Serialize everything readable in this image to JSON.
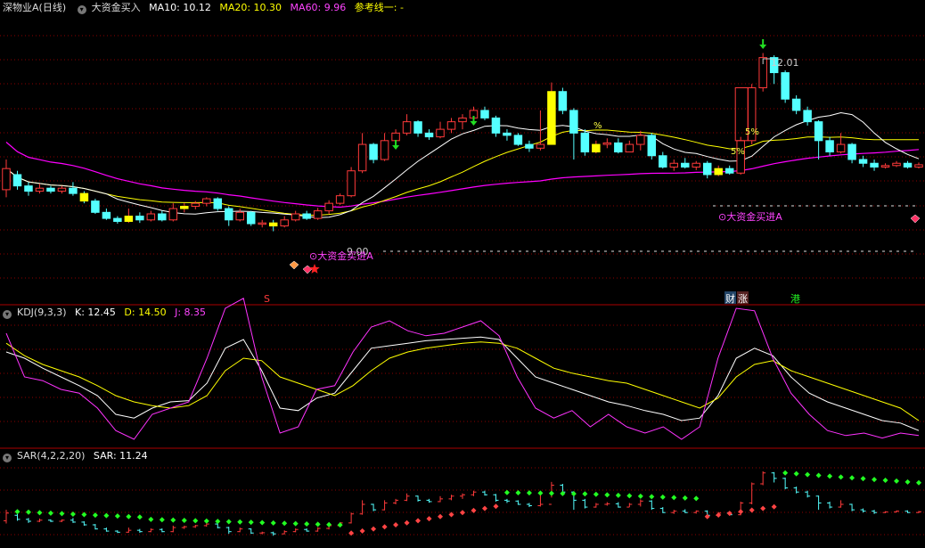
{
  "colors": {
    "up": "#ff3a3a",
    "down": "#54ffff",
    "ma10": "#ffffff",
    "ma20": "#ffff00",
    "ma60": "#ff00ff",
    "grid": "#8b0000",
    "refline": "#ffffff",
    "arrow": "#22dd22",
    "bigfund": "#ff44ff",
    "sar_green": "#22ff22",
    "sar_red": "#ff4444"
  },
  "main_header": {
    "symbol": "深物业A(日线)",
    "indicator": "大资金买入",
    "ma10": "MA10: 10.12",
    "ma20": "MA20: 10.30",
    "ma60": "MA60: 9.96",
    "ref": "参考线一: -"
  },
  "kdj_header": {
    "name": "KDJ(9,3,3)",
    "k": "K: 12.45",
    "d": "D: 14.50",
    "j": "J: 8.35"
  },
  "sar_header": {
    "name": "SAR(4,2,2,20)",
    "sar": "SAR: 11.24"
  },
  "annotations": {
    "high_price": "12.01",
    "low_price": "9.00",
    "bigfund_1": "⊙大资金买进A",
    "bigfund_2": "⊙大资金买进A",
    "pct_1": "%",
    "pct_2": "5%",
    "pct_3": "5%",
    "event_s": "S",
    "event_cai": "财",
    "event_zhang": "涨",
    "event_gang": "港"
  },
  "chart_data": {
    "type": "candlestick",
    "y_range": [
      8.7,
      12.5
    ],
    "candles": [
      [
        10.2,
        10.48,
        10.6,
        10.1
      ],
      [
        10.4,
        10.25,
        10.45,
        10.2
      ],
      [
        10.25,
        10.18,
        10.3,
        10.12
      ],
      [
        10.18,
        10.22,
        10.28,
        10.15
      ],
      [
        10.22,
        10.18,
        10.25,
        10.15
      ],
      [
        10.18,
        10.22,
        10.25,
        10.15
      ],
      [
        10.22,
        10.15,
        10.3,
        10.12
      ],
      [
        10.15,
        10.05,
        10.18,
        10.02
      ],
      [
        10.05,
        9.9,
        10.08,
        9.88
      ],
      [
        9.9,
        9.82,
        9.95,
        9.8
      ],
      [
        9.82,
        9.78,
        9.85,
        9.75
      ],
      [
        9.78,
        9.85,
        9.95,
        9.76
      ],
      [
        9.85,
        9.8,
        9.9,
        9.76
      ],
      [
        9.8,
        9.88,
        9.92,
        9.78
      ],
      [
        9.88,
        9.8,
        9.92,
        9.78
      ],
      [
        9.8,
        9.95,
        10.02,
        9.78
      ],
      [
        9.95,
        9.98,
        10.02,
        9.9
      ],
      [
        9.98,
        10.02,
        10.05,
        9.94
      ],
      [
        10.02,
        10.08,
        10.1,
        9.98
      ],
      [
        10.08,
        9.95,
        10.1,
        9.92
      ],
      [
        9.95,
        9.8,
        9.98,
        9.72
      ],
      [
        9.8,
        9.9,
        9.95,
        9.78
      ],
      [
        9.9,
        9.75,
        9.92,
        9.72
      ],
      [
        9.75,
        9.76,
        9.8,
        9.7
      ],
      [
        9.76,
        9.72,
        9.8,
        9.65
      ],
      [
        9.72,
        9.8,
        9.85,
        9.7
      ],
      [
        9.8,
        9.88,
        9.92,
        9.78
      ],
      [
        9.88,
        9.82,
        9.92,
        9.8
      ],
      [
        9.82,
        9.92,
        9.96,
        9.8
      ],
      [
        9.92,
        10.02,
        10.06,
        9.88
      ],
      [
        10.02,
        10.12,
        10.15,
        10.0
      ],
      [
        10.12,
        10.45,
        10.5,
        10.1
      ],
      [
        10.45,
        10.8,
        10.95,
        10.42
      ],
      [
        10.8,
        10.6,
        10.82,
        10.55
      ],
      [
        10.6,
        10.85,
        10.95,
        10.58
      ],
      [
        10.85,
        10.95,
        11.0,
        10.8
      ],
      [
        10.95,
        11.1,
        11.2,
        10.92
      ],
      [
        11.1,
        10.95,
        11.12,
        10.9
      ],
      [
        10.95,
        10.9,
        11.0,
        10.86
      ],
      [
        10.9,
        11.0,
        11.1,
        10.88
      ],
      [
        11.0,
        11.1,
        11.15,
        10.95
      ],
      [
        11.1,
        11.15,
        11.2,
        11.0
      ],
      [
        11.15,
        11.25,
        11.3,
        11.1
      ],
      [
        11.25,
        11.15,
        11.3,
        11.12
      ],
      [
        11.15,
        10.95,
        11.18,
        10.9
      ],
      [
        10.95,
        10.92,
        11.0,
        10.85
      ],
      [
        10.92,
        10.8,
        10.95,
        10.78
      ],
      [
        10.8,
        10.75,
        10.85,
        10.7
      ],
      [
        10.75,
        10.8,
        11.25,
        10.72
      ],
      [
        10.8,
        11.5,
        11.62,
        11.05
      ],
      [
        11.5,
        11.25,
        11.55,
        11.2
      ],
      [
        11.25,
        10.95,
        11.28,
        10.6
      ],
      [
        10.95,
        10.7,
        11.0,
        10.65
      ],
      [
        10.7,
        10.8,
        10.85,
        10.68
      ],
      [
        10.8,
        10.82,
        10.88,
        10.75
      ],
      [
        10.82,
        10.7,
        10.88,
        10.68
      ],
      [
        10.7,
        10.8,
        10.85,
        10.7
      ],
      [
        10.8,
        10.92,
        10.98,
        10.72
      ],
      [
        10.92,
        10.65,
        10.95,
        10.6
      ],
      [
        10.65,
        10.5,
        10.7,
        10.48
      ],
      [
        10.5,
        10.55,
        10.6,
        10.45
      ],
      [
        10.55,
        10.5,
        10.62,
        10.48
      ],
      [
        10.5,
        10.55,
        10.58,
        10.46
      ],
      [
        10.55,
        10.4,
        10.58,
        10.35
      ],
      [
        10.4,
        10.48,
        10.52,
        10.38
      ],
      [
        10.48,
        10.42,
        10.52,
        10.4
      ],
      [
        10.42,
        10.85,
        10.9,
        10.4
      ],
      [
        10.85,
        11.55,
        11.6,
        10.8
      ],
      [
        11.55,
        11.95,
        12.01,
        11.5
      ],
      [
        11.95,
        11.75,
        11.98,
        11.6
      ],
      [
        11.75,
        11.4,
        11.78,
        11.35
      ],
      [
        11.4,
        11.25,
        11.45,
        11.2
      ],
      [
        11.25,
        11.1,
        11.3,
        11.05
      ],
      [
        11.1,
        10.85,
        11.12,
        10.6
      ],
      [
        10.85,
        10.7,
        10.9,
        10.65
      ],
      [
        10.7,
        10.8,
        10.95,
        10.68
      ],
      [
        10.8,
        10.6,
        10.82,
        10.55
      ],
      [
        10.6,
        10.55,
        10.65,
        10.5
      ],
      [
        10.55,
        10.5,
        10.6,
        10.45
      ],
      [
        10.5,
        10.52,
        10.55,
        10.48
      ],
      [
        10.52,
        10.55,
        10.58,
        10.5
      ],
      [
        10.55,
        10.5,
        10.58,
        10.48
      ],
      [
        10.5,
        10.53,
        10.56,
        10.48
      ]
    ]
  }
}
